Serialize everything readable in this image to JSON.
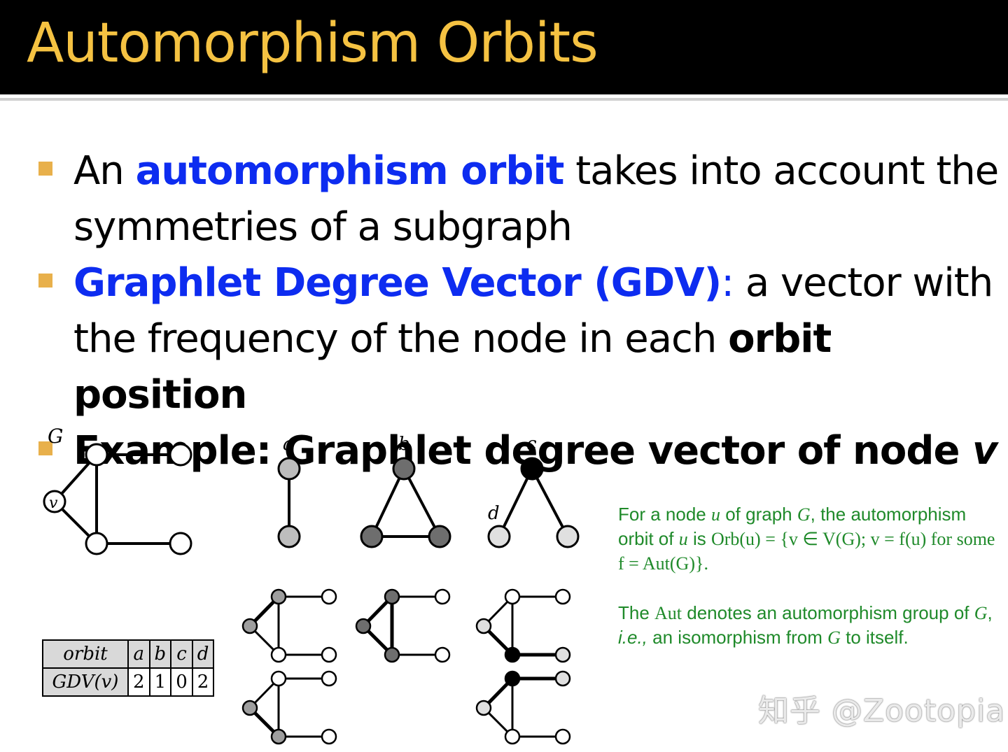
{
  "slide": {
    "title": "Automorphism Orbits"
  },
  "bullets": [
    {
      "pre": "An ",
      "highlight": "automorphism orbit",
      "post": " takes into account the symmetries of a subgraph"
    },
    {
      "highlight": "Graphlet Degree Vector (GDV)",
      "post_colon": ":",
      "post": " a vector with the frequency of the node in each ",
      "bold": "orbit position"
    },
    {
      "bold": "Example: Graphlet degree vector of node ",
      "bold_italic": "v"
    }
  ],
  "figure": {
    "graph_label": "G",
    "node_v_label": "v",
    "orbit_labels": {
      "a": "a",
      "b": "b",
      "c": "c",
      "d": "d"
    },
    "table": {
      "header_label": "orbit",
      "row_label": "GDV(v)",
      "columns": [
        "a",
        "b",
        "c",
        "d"
      ],
      "values": [
        "2",
        "1",
        "0",
        "2"
      ]
    }
  },
  "note": {
    "p1_a": "For a node ",
    "p1_u": "u",
    "p1_b": " of graph ",
    "p1_G": "G",
    "p1_c": ", the automorphism orbit of ",
    "p1_u2": "u",
    "p1_d": " is ",
    "p1_formula": "Orb(u) = {v ∈ V(G); v = f(u) for some f = Aut(G)}.",
    "p2_a": "The ",
    "p2_aut": "Aut",
    "p2_b": " denotes an automorphism group of ",
    "p2_G": "G",
    "p2_c": ", ",
    "p2_ie": "i.e.,",
    "p2_d": " an isomorphism from ",
    "p2_G2": "G",
    "p2_e": " to itself."
  },
  "watermark": "知乎 @Zootopia",
  "colors": {
    "title": "#f5c242",
    "highlight": "#0d2cf0",
    "bullet_marker": "#e8b04b",
    "note_text": "#1f8a2a"
  }
}
